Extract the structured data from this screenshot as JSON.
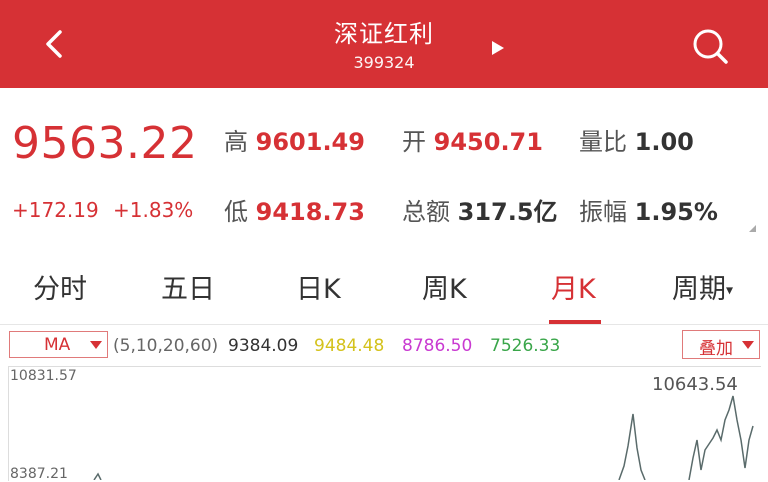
{
  "header": {
    "title": "深证红利",
    "code": "399324",
    "back_icon": "chevron-left-icon",
    "next_icon": "triangle-right-icon",
    "search_icon": "search-icon",
    "bg_color": "#d63135"
  },
  "quote": {
    "price": "9563.22",
    "change": "+172.19",
    "change_pct": "+1.83%",
    "high_label": "高",
    "high": "9601.49",
    "open_label": "开",
    "open": "9450.71",
    "volume_ratio_label": "量比",
    "volume_ratio": "1.00",
    "low_label": "低",
    "low": "9418.73",
    "turnover_label": "总额",
    "turnover": "317.5亿",
    "amplitude_label": "振幅",
    "amplitude": "1.95%"
  },
  "tabs": {
    "items": [
      "分时",
      "五日",
      "日K",
      "周K",
      "月K",
      "周期"
    ],
    "active": "月K"
  },
  "ma": {
    "selector": "MA",
    "params": "(5,10,20,60)",
    "values": [
      "9384.09",
      "9484.48",
      "8786.50",
      "7526.33"
    ],
    "colors": [
      "#333333",
      "#d4c21c",
      "#c93ad1",
      "#3aa64a"
    ],
    "overlay_label": "叠加"
  },
  "chart": {
    "y_max_label": "10831.57",
    "y_mid_label": "8387.21",
    "peak_label": "10643.54",
    "line_color": "#5a6b6b"
  }
}
